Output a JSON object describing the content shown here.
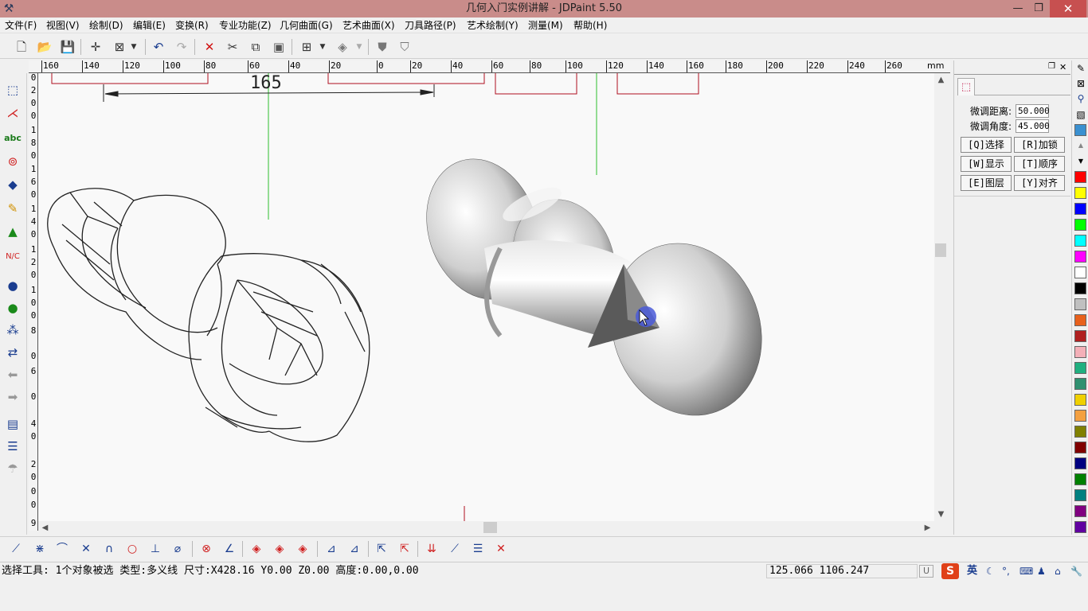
{
  "window": {
    "title": "几何入门实例讲解 - JDPaint 5.50",
    "minimize": "—",
    "maximize": "❐",
    "close": "✕"
  },
  "menu": [
    "文件(F)",
    "视图(V)",
    "绘制(D)",
    "编辑(E)",
    "变换(R)",
    "专业功能(Z)",
    "几何曲面(G)",
    "艺术曲面(X)",
    "刀具路径(P)",
    "艺术绘制(Y)",
    "测量(M)",
    "帮助(H)"
  ],
  "ruler": {
    "unit": "mm",
    "h_labels": [
      "160",
      "140",
      "120",
      "100",
      "80",
      "60",
      "40",
      "20",
      "0",
      "20",
      "40",
      "60",
      "80",
      "100",
      "120",
      "140",
      "160",
      "180",
      "200",
      "220",
      "240",
      "260"
    ],
    "v_labels": [
      "0",
      "2",
      "0",
      "0",
      "1",
      "8",
      "0",
      "1",
      "6",
      "0",
      "1",
      "4",
      "0",
      "1",
      "2",
      "0",
      "1",
      "0",
      "0",
      "8",
      "0",
      "6",
      "0",
      "4",
      "0",
      "2",
      "0",
      "0",
      "0",
      "9"
    ]
  },
  "canvas": {
    "dimension_text": "165"
  },
  "panel": {
    "fine_distance_label": "微调距离:",
    "fine_distance_value": "50.000",
    "fine_angle_label": "微调角度:",
    "fine_angle_value": "45.000",
    "buttons": [
      "[Q]选择",
      "[R]加锁",
      "[W]显示",
      "[T]顺序",
      "[E]图层",
      "[Y]对齐"
    ]
  },
  "colors": [
    "#ff0000",
    "#ffff00",
    "#0000ff",
    "#00ff00",
    "#00ffff",
    "#ff00ff",
    "#ffffff",
    "#000000",
    "#c0c0c0",
    "#e8601c",
    "#b02020",
    "#f4b0b8",
    "#20b080",
    "#309070",
    "#f0d000",
    "#f4a040",
    "#808000",
    "#800000",
    "#000080",
    "#008000",
    "#008080",
    "#800080",
    "#6000a0"
  ],
  "status": {
    "text": "选择工具: 1个对象被选 类型:多义线 尺寸:X428.16 Y0.00 Z0.00 高度:0.00,0.00",
    "coords": "125.066 1106.247",
    "ime_mode": "英"
  }
}
